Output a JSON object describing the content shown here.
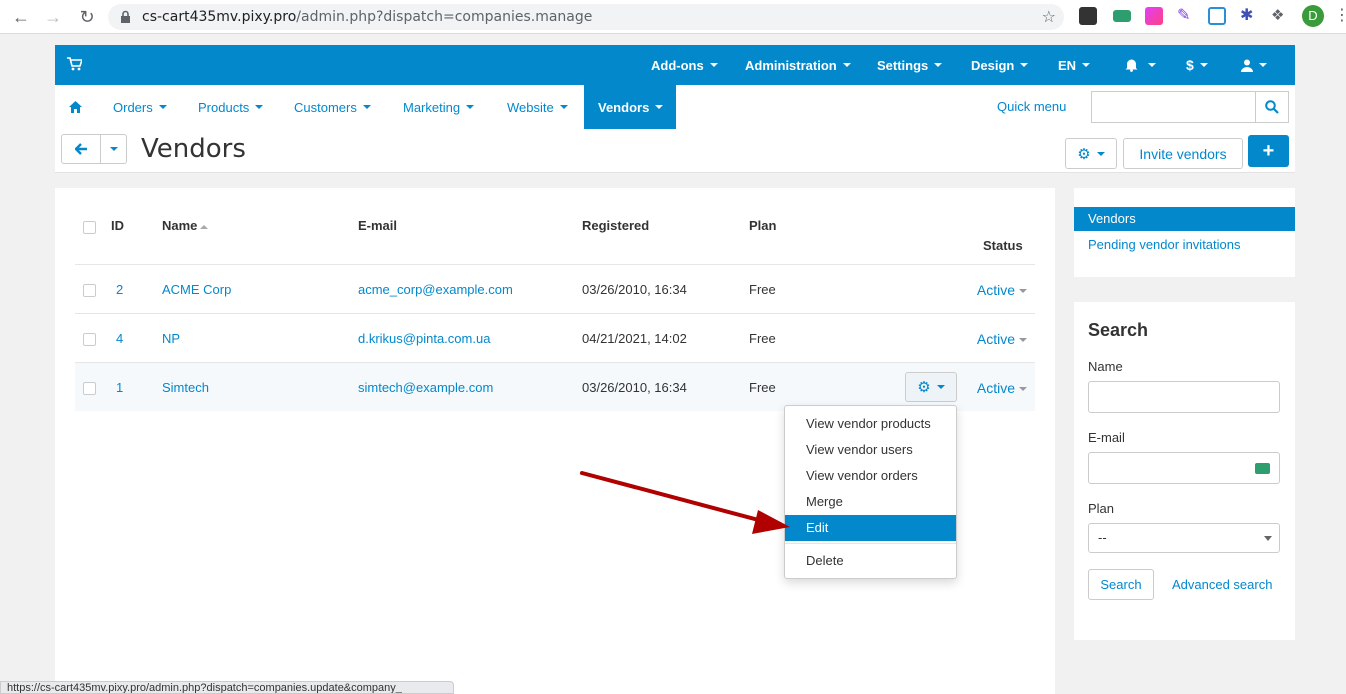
{
  "browser": {
    "url_host": "cs-cart435mv.pixy.pro",
    "url_path": "/admin.php?dispatch=companies.manage",
    "profile_initial": "D",
    "status_url": "https://cs-cart435mv.pixy.pro/admin.php?dispatch=companies.update&company_"
  },
  "topbar": {
    "menus": [
      "Add-ons",
      "Administration",
      "Settings",
      "Design",
      "EN"
    ]
  },
  "nav": {
    "items": [
      "Orders",
      "Products",
      "Customers",
      "Marketing",
      "Website",
      "Vendors"
    ],
    "active": "Vendors",
    "quick_menu": "Quick menu"
  },
  "header": {
    "title": "Vendors",
    "invite_button": "Invite vendors"
  },
  "table": {
    "columns": {
      "id": "ID",
      "name": "Name",
      "email": "E-mail",
      "registered": "Registered",
      "plan": "Plan",
      "status": "Status"
    },
    "rows": [
      {
        "id": "2",
        "name": "ACME Corp",
        "email": "acme_corp@example.com",
        "registered": "03/26/2010, 16:34",
        "plan": "Free",
        "status": "Active"
      },
      {
        "id": "4",
        "name": "NP",
        "email": "d.krikus@pinta.com.ua",
        "registered": "04/21/2021, 14:02",
        "plan": "Free",
        "status": "Active"
      },
      {
        "id": "1",
        "name": "Simtech",
        "email": "simtech@example.com",
        "registered": "03/26/2010, 16:34",
        "plan": "Free",
        "status": "Active"
      }
    ]
  },
  "dropdown": {
    "items": [
      "View vendor products",
      "View vendor users",
      "View vendor orders",
      "Merge",
      "Edit",
      "Delete"
    ],
    "active": "Edit"
  },
  "sidebar": {
    "nav": [
      "Vendors",
      "Pending vendor invitations"
    ],
    "search_title": "Search",
    "name_label": "Name",
    "email_label": "E-mail",
    "plan_label": "Plan",
    "plan_value": "--",
    "search_button": "Search",
    "advanced_link": "Advanced search"
  },
  "colors": {
    "accent": "#0388cc",
    "arrow": "#b00000"
  }
}
